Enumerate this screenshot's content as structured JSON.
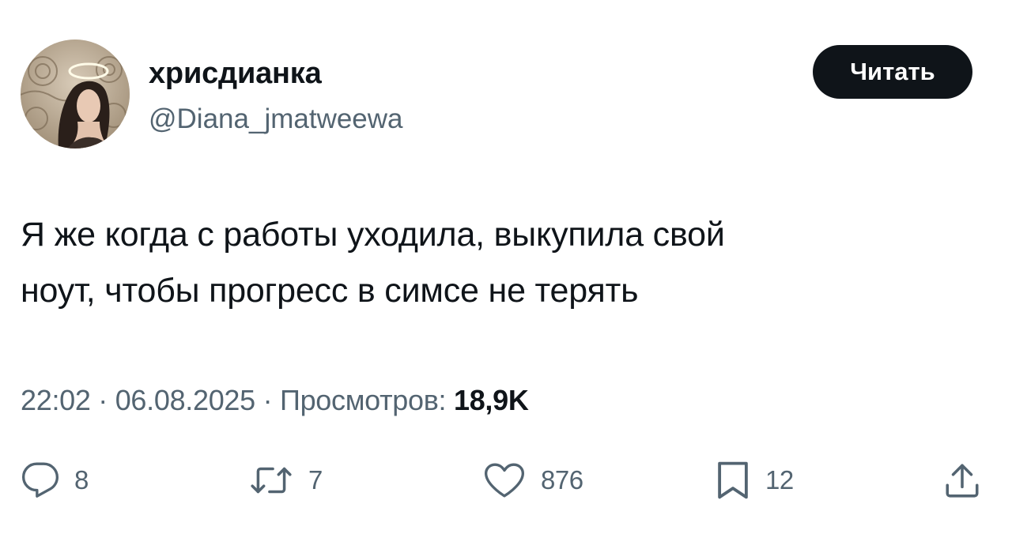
{
  "author": {
    "display_name": "хрисдианка",
    "handle": "@Diana_jmatweewa"
  },
  "follow_button": {
    "label": "Читать"
  },
  "tweet": {
    "text_line_1": "Я же когда с работы уходила, выкупила свой",
    "text_line_2": "ноут, чтобы прогресс в симсе не терять"
  },
  "meta": {
    "time": "22:02",
    "separator": "·",
    "date": "06.08.2025",
    "views_label": "Просмотров:",
    "views_count": "18,9K"
  },
  "actions": {
    "replies": "8",
    "retweets": "7",
    "likes": "876",
    "bookmarks": "12"
  },
  "icons": {
    "reply": "speech-bubble-icon",
    "retweet": "retweet-arrows-icon",
    "like": "heart-icon",
    "bookmark": "bookmark-icon",
    "share": "share-upload-icon"
  },
  "colors": {
    "text_primary": "#0f1419",
    "text_secondary": "#536471",
    "button_bg": "#0f1419",
    "button_text": "#ffffff"
  }
}
